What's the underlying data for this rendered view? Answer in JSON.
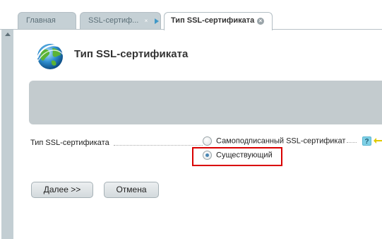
{
  "tabs": [
    {
      "label": "Главная"
    },
    {
      "label": "SSL-сертиф...",
      "close": "×"
    },
    {
      "label": "Тип SSL-сертификата",
      "close": "×"
    }
  ],
  "page": {
    "title": "Тип SSL-сертификата"
  },
  "form": {
    "field_label": "Тип SSL-сертификата",
    "options": [
      {
        "label": "Самоподписанный SSL-сертификат",
        "selected": false
      },
      {
        "label": "Существующий",
        "selected": true
      }
    ],
    "help": "?"
  },
  "buttons": {
    "next": "Далее >>",
    "cancel": "Отмена"
  },
  "colors": {
    "highlight": "#d90000",
    "banner": "#c3cbce",
    "tab_inactive": "#c5d0d5"
  }
}
